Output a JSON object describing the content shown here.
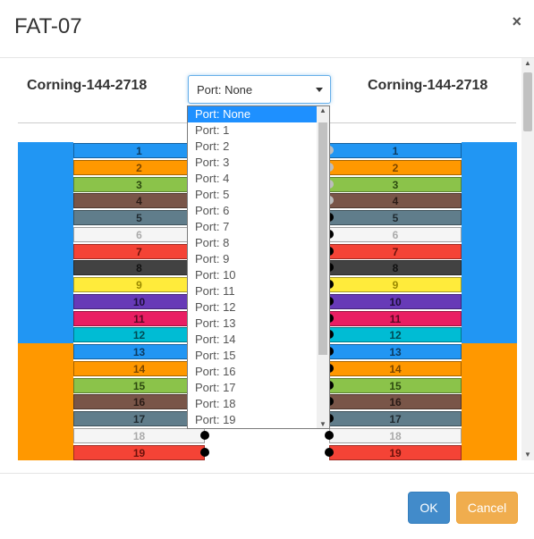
{
  "modal": {
    "title": "FAT-07",
    "close_label": "×"
  },
  "cables": {
    "left_name": "Corning-144-2718",
    "right_name": "Corning-144-2718"
  },
  "port_select": {
    "value": "Port: None"
  },
  "dropdown_options": [
    "Port: None",
    "Port: 1",
    "Port: 2",
    "Port: 3",
    "Port: 4",
    "Port: 5",
    "Port: 6",
    "Port: 7",
    "Port: 8",
    "Port: 9",
    "Port: 10",
    "Port: 11",
    "Port: 12",
    "Port: 13",
    "Port: 14",
    "Port: 15",
    "Port: 16",
    "Port: 17",
    "Port: 18",
    "Port: 19"
  ],
  "tubes": [
    {
      "color": "#2196f3"
    },
    {
      "color": "#ff9800"
    }
  ],
  "fibers": [
    {
      "n": "1",
      "bg": "#2196f3",
      "fg": "#0d3c61"
    },
    {
      "n": "2",
      "bg": "#ff9800",
      "fg": "#7a4600"
    },
    {
      "n": "3",
      "bg": "#8bc34a",
      "fg": "#2d4a10"
    },
    {
      "n": "4",
      "bg": "#795548",
      "fg": "#2a1b16"
    },
    {
      "n": "5",
      "bg": "#607d8b",
      "fg": "#1f2a30"
    },
    {
      "n": "6",
      "bg": "#f5f5f5",
      "fg": "#aaaaaa"
    },
    {
      "n": "7",
      "bg": "#f44336",
      "fg": "#6b120c"
    },
    {
      "n": "8",
      "bg": "#424242",
      "fg": "#111111"
    },
    {
      "n": "9",
      "bg": "#ffeb3b",
      "fg": "#9b8a00"
    },
    {
      "n": "10",
      "bg": "#673ab7",
      "fg": "#1e0f3a"
    },
    {
      "n": "11",
      "bg": "#e91e63",
      "fg": "#5a0a23"
    },
    {
      "n": "12",
      "bg": "#00bcd4",
      "fg": "#004b55"
    },
    {
      "n": "13",
      "bg": "#2196f3",
      "fg": "#0d3c61"
    },
    {
      "n": "14",
      "bg": "#ff9800",
      "fg": "#7a4600"
    },
    {
      "n": "15",
      "bg": "#8bc34a",
      "fg": "#2d4a10"
    },
    {
      "n": "16",
      "bg": "#795548",
      "fg": "#2a1b16"
    },
    {
      "n": "17",
      "bg": "#607d8b",
      "fg": "#1f2a30"
    },
    {
      "n": "18",
      "bg": "#f5f5f5",
      "fg": "#aaaaaa"
    },
    {
      "n": "19",
      "bg": "#f44336",
      "fg": "#6b120c"
    }
  ],
  "buttons": {
    "ok": "OK",
    "cancel": "Cancel"
  }
}
